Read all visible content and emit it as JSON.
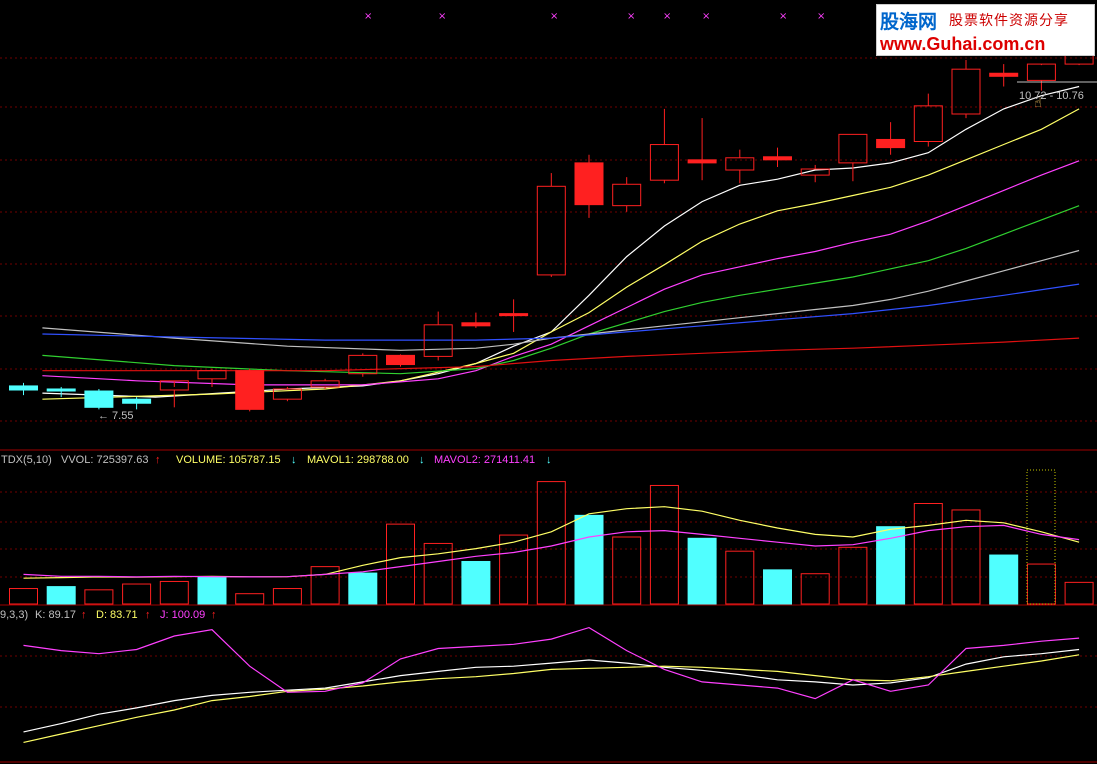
{
  "colors": {
    "up": "#ff2020",
    "down": "#50ffff",
    "grid": "#700000",
    "ma1": "#ffffff",
    "ma2": "#ffff66",
    "ma3": "#ff40ff",
    "ma4": "#30d030",
    "ma5": "#c0c0c0",
    "ma6": "#3050ff",
    "ma7": "#e01010"
  },
  "indicators": {
    "vol_title": "TDX(5,10)",
    "vvol": "VVOL: 725397.63",
    "volume": "VOLUME: 105787.15",
    "mavol1": "MAVOL1: 298788.00",
    "mavol2": "MAVOL2: 271411.41",
    "kdj_title": "9,3,3)",
    "k": "K: 89.17",
    "d": "D: 83.71",
    "j": "J: 100.09",
    "up_arrow": "↑",
    "down_arrow": "↓"
  },
  "annotations": {
    "low_price": "← 7.55",
    "range": "10.72 - 10.76"
  },
  "watermark": {
    "logo": "股海网",
    "tagline": "股票软件资源分享",
    "url": "www.Guhai.com.cn"
  },
  "chart_data": [
    {
      "type": "candlestick",
      "x": [
        1,
        2,
        3,
        4,
        5,
        6,
        7,
        8,
        9,
        10,
        11,
        12,
        13,
        14,
        15,
        16,
        17,
        18,
        19,
        20,
        21,
        22,
        23,
        24,
        25,
        26,
        27,
        28
      ],
      "candles": [
        {
          "o": 7.83,
          "h": 7.86,
          "l": 7.74,
          "c": 7.79,
          "color": "down"
        },
        {
          "o": 7.8,
          "h": 7.82,
          "l": 7.72,
          "c": 7.78,
          "color": "down"
        },
        {
          "o": 7.78,
          "h": 7.8,
          "l": 7.6,
          "c": 7.62,
          "color": "down"
        },
        {
          "o": 7.7,
          "h": 7.72,
          "l": 7.6,
          "c": 7.66,
          "color": "down"
        },
        {
          "o": 7.79,
          "h": 7.82,
          "l": 7.62,
          "c": 7.88,
          "color": "up"
        },
        {
          "o": 7.9,
          "h": 8.0,
          "l": 7.82,
          "c": 7.98,
          "color": "up"
        },
        {
          "o": 7.98,
          "h": 8.0,
          "l": 7.58,
          "c": 7.6,
          "color": "up_solid"
        },
        {
          "o": 7.7,
          "h": 7.82,
          "l": 7.68,
          "c": 7.8,
          "color": "up"
        },
        {
          "o": 7.82,
          "h": 7.9,
          "l": 7.8,
          "c": 7.88,
          "color": "up"
        },
        {
          "o": 7.95,
          "h": 8.15,
          "l": 7.92,
          "c": 8.13,
          "color": "up"
        },
        {
          "o": 8.13,
          "h": 8.14,
          "l": 8.02,
          "c": 8.04,
          "color": "up_solid"
        },
        {
          "o": 8.12,
          "h": 8.56,
          "l": 8.08,
          "c": 8.43,
          "color": "up"
        },
        {
          "o": 8.45,
          "h": 8.55,
          "l": 8.4,
          "c": 8.42,
          "color": "up_solid"
        },
        {
          "o": 8.54,
          "h": 8.68,
          "l": 8.36,
          "c": 8.53,
          "color": "up_solid"
        },
        {
          "o": 8.92,
          "h": 9.92,
          "l": 8.9,
          "c": 9.79,
          "color": "up"
        },
        {
          "o": 10.02,
          "h": 10.1,
          "l": 9.48,
          "c": 9.61,
          "color": "up_solid"
        },
        {
          "o": 9.6,
          "h": 9.88,
          "l": 9.54,
          "c": 9.81,
          "color": "up"
        },
        {
          "o": 9.85,
          "h": 10.55,
          "l": 9.82,
          "c": 10.2,
          "color": "up"
        },
        {
          "o": 10.05,
          "h": 10.46,
          "l": 9.85,
          "c": 10.02,
          "color": "up_solid"
        },
        {
          "o": 9.95,
          "h": 10.15,
          "l": 9.82,
          "c": 10.07,
          "color": "up"
        },
        {
          "o": 10.08,
          "h": 10.17,
          "l": 9.98,
          "c": 10.05,
          "color": "up_solid"
        },
        {
          "o": 9.9,
          "h": 10.0,
          "l": 9.83,
          "c": 9.96,
          "color": "up"
        },
        {
          "o": 10.02,
          "h": 10.3,
          "l": 9.84,
          "c": 10.3,
          "color": "up"
        },
        {
          "o": 10.25,
          "h": 10.42,
          "l": 10.1,
          "c": 10.17,
          "color": "up_solid"
        },
        {
          "o": 10.23,
          "h": 10.7,
          "l": 10.18,
          "c": 10.58,
          "color": "up"
        },
        {
          "o": 10.5,
          "h": 11.03,
          "l": 10.46,
          "c": 10.94,
          "color": "up"
        },
        {
          "o": 10.9,
          "h": 10.99,
          "l": 10.77,
          "c": 10.87,
          "color": "up_solid"
        },
        {
          "o": 10.83,
          "h": 10.98,
          "l": 10.73,
          "c": 10.99,
          "color": "up"
        },
        {
          "o": 10.99,
          "h": 11.3,
          "l": 10.98,
          "c": 11.2,
          "color": "up"
        }
      ],
      "lines": [
        {
          "key": "ma1",
          "points": [
            [
              0.5,
              7.76
            ],
            [
              3.5,
              7.72
            ],
            [
              7,
              7.8
            ],
            [
              9,
              7.83
            ],
            [
              10,
              7.88
            ],
            [
              11,
              7.95
            ],
            [
              12,
              8.05
            ],
            [
              13,
              8.22
            ],
            [
              14,
              8.36
            ],
            [
              15,
              8.72
            ],
            [
              16,
              9.1
            ],
            [
              17,
              9.4
            ],
            [
              18,
              9.64
            ],
            [
              19,
              9.8
            ],
            [
              20,
              9.86
            ],
            [
              21,
              9.95
            ],
            [
              22,
              9.97
            ],
            [
              23,
              10.02
            ],
            [
              24,
              10.12
            ],
            [
              25,
              10.35
            ],
            [
              26,
              10.55
            ],
            [
              27,
              10.68
            ],
            [
              28,
              10.77
            ]
          ]
        },
        {
          "key": "ma2",
          "points": [
            [
              0.5,
              7.7
            ],
            [
              5,
              7.75
            ],
            [
              8,
              7.8
            ],
            [
              10,
              7.88
            ],
            [
              12,
              8.05
            ],
            [
              13,
              8.15
            ],
            [
              14,
              8.36
            ],
            [
              15,
              8.55
            ],
            [
              16,
              8.8
            ],
            [
              17,
              9.02
            ],
            [
              18,
              9.25
            ],
            [
              19,
              9.42
            ],
            [
              20,
              9.55
            ],
            [
              21,
              9.62
            ],
            [
              22,
              9.7
            ],
            [
              23,
              9.78
            ],
            [
              24,
              9.9
            ],
            [
              25,
              10.05
            ],
            [
              26,
              10.2
            ],
            [
              27,
              10.35
            ],
            [
              28,
              10.55
            ]
          ]
        },
        {
          "key": "ma3",
          "points": [
            [
              0.5,
              7.93
            ],
            [
              3,
              7.88
            ],
            [
              6,
              7.84
            ],
            [
              9,
              7.84
            ],
            [
              11,
              7.9
            ],
            [
              12,
              7.98
            ],
            [
              13,
              8.12
            ],
            [
              14,
              8.24
            ],
            [
              15,
              8.42
            ],
            [
              16,
              8.6
            ],
            [
              17,
              8.78
            ],
            [
              18,
              8.92
            ],
            [
              19,
              9.0
            ],
            [
              20,
              9.08
            ],
            [
              21,
              9.15
            ],
            [
              22,
              9.24
            ],
            [
              23,
              9.32
            ],
            [
              24,
              9.45
            ],
            [
              25,
              9.6
            ],
            [
              26,
              9.75
            ],
            [
              27,
              9.9
            ],
            [
              28,
              10.04
            ]
          ]
        },
        {
          "key": "ma4",
          "points": [
            [
              0.5,
              8.13
            ],
            [
              4,
              8.03
            ],
            [
              7,
              7.98
            ],
            [
              10,
              7.95
            ],
            [
              12,
              8.0
            ],
            [
              13,
              8.08
            ],
            [
              14,
              8.2
            ],
            [
              15,
              8.34
            ],
            [
              16,
              8.45
            ],
            [
              17,
              8.56
            ],
            [
              18,
              8.65
            ],
            [
              19,
              8.72
            ],
            [
              20,
              8.78
            ],
            [
              21,
              8.84
            ],
            [
              22,
              8.9
            ],
            [
              23,
              8.98
            ],
            [
              24,
              9.06
            ],
            [
              25,
              9.18
            ],
            [
              26,
              9.32
            ],
            [
              27,
              9.46
            ],
            [
              28,
              9.6
            ]
          ]
        },
        {
          "key": "ma5",
          "points": [
            [
              0.5,
              8.4
            ],
            [
              4,
              8.3
            ],
            [
              7,
              8.22
            ],
            [
              10,
              8.18
            ],
            [
              12,
              8.2
            ],
            [
              13,
              8.24
            ],
            [
              14,
              8.3
            ],
            [
              15,
              8.34
            ],
            [
              16,
              8.38
            ],
            [
              17,
              8.42
            ],
            [
              18,
              8.46
            ],
            [
              19,
              8.5
            ],
            [
              20,
              8.54
            ],
            [
              21,
              8.58
            ],
            [
              22,
              8.62
            ],
            [
              23,
              8.68
            ],
            [
              24,
              8.76
            ],
            [
              25,
              8.86
            ],
            [
              26,
              8.96
            ],
            [
              27,
              9.06
            ],
            [
              28,
              9.16
            ]
          ]
        },
        {
          "key": "ma6",
          "points": [
            [
              0.5,
              8.34
            ],
            [
              4,
              8.31
            ],
            [
              8,
              8.28
            ],
            [
              12,
              8.28
            ],
            [
              14,
              8.3
            ],
            [
              16,
              8.36
            ],
            [
              18,
              8.42
            ],
            [
              20,
              8.48
            ],
            [
              22,
              8.54
            ],
            [
              24,
              8.62
            ],
            [
              26,
              8.72
            ],
            [
              28,
              8.83
            ]
          ]
        },
        {
          "key": "ma7",
          "points": [
            [
              0.5,
              7.98
            ],
            [
              4,
              7.98
            ],
            [
              8,
              7.98
            ],
            [
              12,
              8.02
            ],
            [
              14,
              8.08
            ],
            [
              16,
              8.12
            ],
            [
              18,
              8.15
            ],
            [
              20,
              8.18
            ],
            [
              22,
              8.2
            ],
            [
              24,
              8.23
            ],
            [
              26,
              8.26
            ],
            [
              28,
              8.3
            ]
          ]
        }
      ],
      "ylim": [
        7.25,
        11.58
      ]
    },
    {
      "type": "bar",
      "title": "TDX(5,10)",
      "values": [
        {
          "v": 120000,
          "color": "up"
        },
        {
          "v": 135000,
          "color": "down"
        },
        {
          "v": 110000,
          "color": "up"
        },
        {
          "v": 155000,
          "color": "up"
        },
        {
          "v": 175000,
          "color": "up"
        },
        {
          "v": 210000,
          "color": "down"
        },
        {
          "v": 80000,
          "color": "up"
        },
        {
          "v": 120000,
          "color": "up"
        },
        {
          "v": 290000,
          "color": "up"
        },
        {
          "v": 240000,
          "color": "down"
        },
        {
          "v": 620000,
          "color": "up"
        },
        {
          "v": 470000,
          "color": "up"
        },
        {
          "v": 330000,
          "color": "down"
        },
        {
          "v": 535000,
          "color": "up"
        },
        {
          "v": 950000,
          "color": "up"
        },
        {
          "v": 688000,
          "color": "down"
        },
        {
          "v": 520000,
          "color": "up"
        },
        {
          "v": 920000,
          "color": "up"
        },
        {
          "v": 510000,
          "color": "down"
        },
        {
          "v": 410000,
          "color": "up"
        },
        {
          "v": 265000,
          "color": "down"
        },
        {
          "v": 235000,
          "color": "up"
        },
        {
          "v": 440000,
          "color": "up"
        },
        {
          "v": 600000,
          "color": "down"
        },
        {
          "v": 780000,
          "color": "up"
        },
        {
          "v": 730000,
          "color": "up"
        },
        {
          "v": 380000,
          "color": "down"
        },
        {
          "v": 310000,
          "color": "up"
        },
        {
          "v": 168000,
          "color": "up"
        }
      ],
      "series": [
        {
          "name": "MAVOL1",
          "color": "#ffff66",
          "values": [
            200000,
            205000,
            210000,
            208000,
            212000,
            215000,
            210000,
            212000,
            230000,
            300000,
            360000,
            390000,
            430000,
            480000,
            560000,
            700000,
            740000,
            755000,
            720000,
            650000,
            590000,
            540000,
            520000,
            580000,
            610000,
            650000,
            630000,
            560000,
            480000
          ]
        },
        {
          "name": "MAVOL2",
          "color": "#ff40ff",
          "values": [
            230000,
            215000,
            215000,
            210000,
            215000,
            212000,
            210000,
            212000,
            230000,
            250000,
            290000,
            330000,
            370000,
            400000,
            450000,
            520000,
            560000,
            570000,
            540000,
            510000,
            480000,
            450000,
            460000,
            510000,
            570000,
            600000,
            610000,
            540000,
            500000
          ]
        }
      ],
      "ylim": [
        0,
        1040000
      ]
    },
    {
      "type": "line",
      "title": "9,3,3)",
      "series": [
        {
          "name": "K",
          "color": "#ffffff",
          "values": [
            10,
            18,
            27,
            33,
            40,
            45,
            48,
            50,
            52,
            58,
            64,
            68,
            72,
            73,
            76,
            79,
            76,
            72,
            69,
            65,
            60,
            58,
            55,
            57,
            62,
            75,
            82,
            85,
            89
          ]
        },
        {
          "name": "D",
          "color": "#ffff66",
          "values": [
            0,
            8,
            16,
            24,
            31,
            40,
            44,
            49,
            51,
            54,
            58,
            61,
            63,
            66,
            70,
            71,
            72,
            73,
            72,
            70,
            68,
            64,
            60,
            59,
            63,
            68,
            73,
            78,
            84
          ]
        },
        {
          "name": "J",
          "color": "#ff40ff",
          "values": [
            93,
            88,
            85,
            89,
            102,
            108,
            73,
            48,
            49,
            57,
            80,
            90,
            92,
            94,
            99,
            110,
            88,
            70,
            58,
            55,
            52,
            42,
            60,
            49,
            55,
            90,
            93,
            97,
            100
          ]
        }
      ],
      "ylim": [
        -15,
        125
      ]
    }
  ]
}
